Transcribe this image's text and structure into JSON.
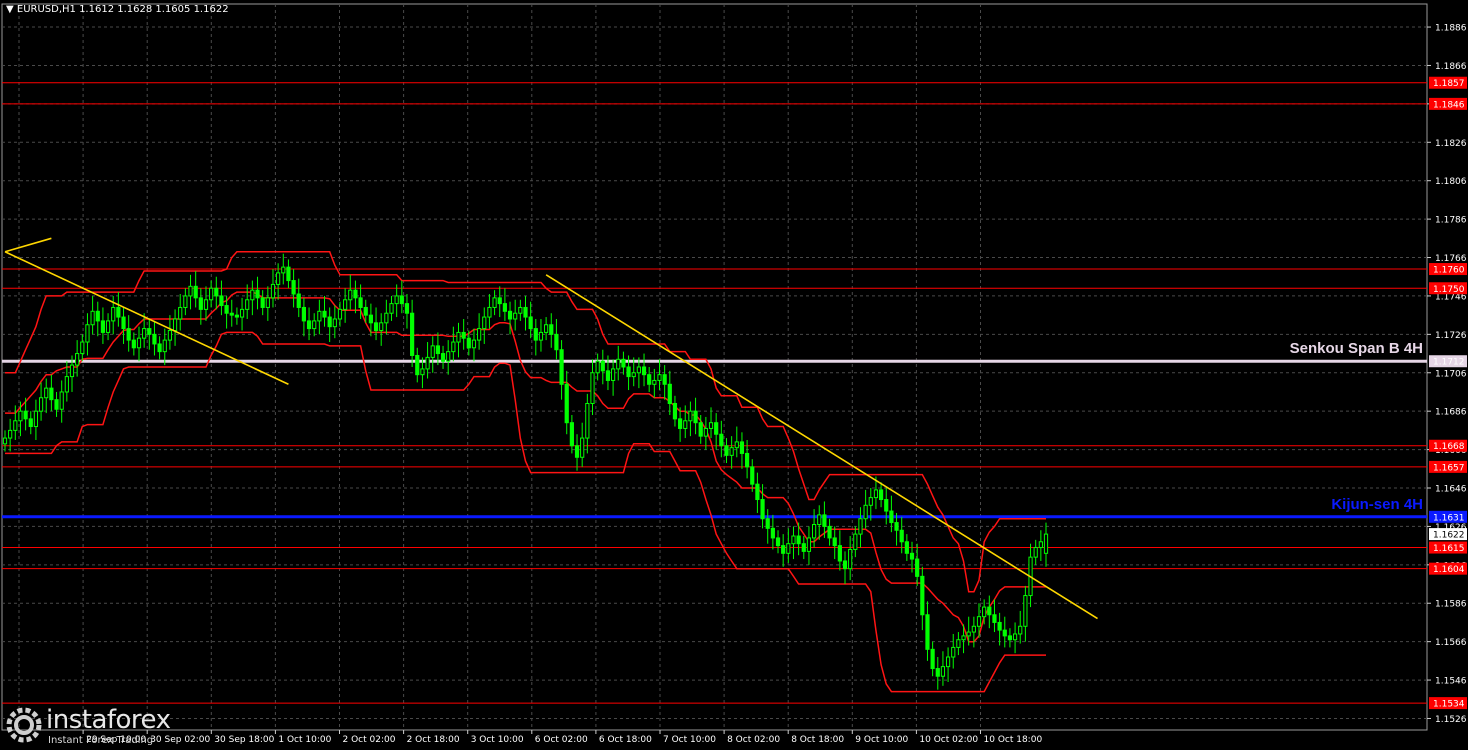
{
  "header": {
    "symbol_line": "EURUSD,H1  1.1612 1.1628 1.1605 1.1622"
  },
  "logo": {
    "name": "instaforex",
    "tagline": "Instant Forex Trading"
  },
  "colors": {
    "background": "#000000",
    "grid": "#4a4a4a",
    "candle": "#00ff00",
    "level_red": "#ff0000",
    "ichimoku": "#ff1414",
    "trend": "#ffd700",
    "kijun": "#0a1aff",
    "senkou": "#e6d6e6",
    "price_label": "#ffffff",
    "axis_text": "#ffffff"
  },
  "chart_data": {
    "type": "candlestick",
    "instrument": "EURUSD",
    "timeframe": "H1",
    "last_bar": {
      "open": 1.1612,
      "high": 1.1628,
      "low": 1.1605,
      "close": 1.1622
    },
    "ylim": [
      1.152,
      1.1898
    ],
    "y_ticks": [
      "1.1886",
      "1.1866",
      "1.1846",
      "1.1826",
      "1.1806",
      "1.1786",
      "1.1766",
      "1.1746",
      "1.1726",
      "1.1706",
      "1.1686",
      "1.1666",
      "1.1646",
      "1.1626",
      "1.1606",
      "1.1586",
      "1.1566",
      "1.1546",
      "1.1526"
    ],
    "x_ticks": [
      "",
      "29 Sep 10:00",
      "30 Sep 02:00",
      "30 Sep 18:00",
      "1 Oct 10:00",
      "2 Oct 02:00",
      "2 Oct 18:00",
      "3 Oct 10:00",
      "6 Oct 02:00",
      "6 Oct 18:00",
      "7 Oct 10:00",
      "8 Oct 02:00",
      "8 Oct 18:00",
      "9 Oct 10:00",
      "10 Oct 02:00",
      "10 Oct 18:00"
    ],
    "horizontal_levels": [
      {
        "value": 1.1857,
        "label": "1.1857",
        "kind": "red"
      },
      {
        "value": 1.1846,
        "label": "1.1846",
        "kind": "red"
      },
      {
        "value": 1.176,
        "label": "1.1760",
        "kind": "red"
      },
      {
        "value": 1.175,
        "label": "1.1750",
        "kind": "red"
      },
      {
        "value": 1.1712,
        "label": "1.1712",
        "kind": "senkou"
      },
      {
        "value": 1.1668,
        "label": "1.1668",
        "kind": "red"
      },
      {
        "value": 1.1657,
        "label": "1.1657",
        "kind": "red"
      },
      {
        "value": 1.1631,
        "label": "1.1631",
        "kind": "kijun"
      },
      {
        "value": 1.1615,
        "label": "1.1615",
        "kind": "red"
      },
      {
        "value": 1.1604,
        "label": "1.1604",
        "kind": "red"
      },
      {
        "value": 1.1534,
        "label": "1.1534",
        "kind": "red"
      }
    ],
    "current_price_label": "1.1622",
    "annotations": [
      {
        "text": "Senkou Span B 4H",
        "anchor_value": 1.1712,
        "color": "#e6d6e6"
      },
      {
        "text": "Kijun-sen 4H",
        "anchor_value": 1.1631,
        "color": "#0a1aff"
      }
    ],
    "close_series": [
      1.1672,
      1.1676,
      1.1681,
      1.1686,
      1.1682,
      1.1678,
      1.1686,
      1.1693,
      1.1698,
      1.1692,
      1.1687,
      1.1696,
      1.1704,
      1.171,
      1.1716,
      1.1722,
      1.1731,
      1.1738,
      1.1733,
      1.1727,
      1.1733,
      1.174,
      1.1735,
      1.1729,
      1.1723,
      1.1719,
      1.1724,
      1.1729,
      1.1726,
      1.1721,
      1.1717,
      1.1723,
      1.1728,
      1.1734,
      1.174,
      1.1746,
      1.1751,
      1.1745,
      1.1739,
      1.1744,
      1.175,
      1.1746,
      1.1741,
      1.1737,
      1.1736,
      1.1735,
      1.1739,
      1.1744,
      1.1749,
      1.1745,
      1.174,
      1.1745,
      1.1752,
      1.1758,
      1.1761,
      1.1754,
      1.1747,
      1.174,
      1.1733,
      1.1729,
      1.1733,
      1.1738,
      1.1735,
      1.173,
      1.1734,
      1.1739,
      1.1744,
      1.1749,
      1.1745,
      1.174,
      1.1736,
      1.1732,
      1.1728,
      1.1732,
      1.1737,
      1.1742,
      1.1746,
      1.1742,
      1.1737,
      1.1715,
      1.1705,
      1.1708,
      1.1714,
      1.172,
      1.1716,
      1.1712,
      1.1717,
      1.1722,
      1.1727,
      1.1724,
      1.1719,
      1.1723,
      1.1729,
      1.1735,
      1.174,
      1.1745,
      1.1742,
      1.1738,
      1.1734,
      1.1737,
      1.174,
      1.1735,
      1.1729,
      1.1723,
      1.1727,
      1.1731,
      1.1726,
      1.1718,
      1.17,
      1.168,
      1.1668,
      1.1662,
      1.1672,
      1.169,
      1.1706,
      1.1712,
      1.1707,
      1.1702,
      1.1708,
      1.1713,
      1.1709,
      1.1704,
      1.1706,
      1.1709,
      1.1705,
      1.17,
      1.1702,
      1.1705,
      1.17,
      1.169,
      1.1682,
      1.1677,
      1.1681,
      1.1686,
      1.168,
      1.1673,
      1.1677,
      1.168,
      1.1674,
      1.1668,
      1.1663,
      1.1667,
      1.167,
      1.1664,
      1.1657,
      1.1648,
      1.164,
      1.163,
      1.1625,
      1.162,
      1.1616,
      1.1612,
      1.1617,
      1.1621,
      1.1617,
      1.1613,
      1.162,
      1.1627,
      1.1632,
      1.1626,
      1.162,
      1.1616,
      1.1608,
      1.1604,
      1.1614,
      1.1622,
      1.163,
      1.1637,
      1.1641,
      1.1645,
      1.164,
      1.1634,
      1.1628,
      1.1624,
      1.1618,
      1.1612,
      1.1609,
      1.16,
      1.158,
      1.1562,
      1.1552,
      1.1548,
      1.1553,
      1.1558,
      1.1563,
      1.1567,
      1.1569,
      1.1571,
      1.1574,
      1.1579,
      1.1584,
      1.158,
      1.1576,
      1.1572,
      1.1569,
      1.1567,
      1.157,
      1.1574,
      1.159,
      1.161,
      1.1615,
      1.1618,
      1.1622
    ]
  }
}
